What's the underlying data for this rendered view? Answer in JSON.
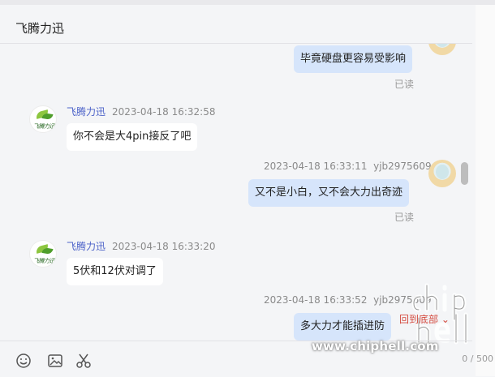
{
  "header": {
    "title": "飞腾力迅"
  },
  "messages": [
    {
      "side": "self",
      "text": "毕竟硬盘更容易受影响",
      "status": "已读"
    },
    {
      "side": "peer",
      "sender": "飞腾力迅",
      "time": "2023-04-18 16:32:58",
      "text": "你不会是大4pin接反了吧"
    },
    {
      "side": "self",
      "sender": "yjb2975609",
      "time": "2023-04-18 16:33:11",
      "text": "又不是小白，又不会大力出奇迹",
      "status": "已读"
    },
    {
      "side": "peer",
      "sender": "飞腾力迅",
      "time": "2023-04-18 16:33:20",
      "text": "5伏和12伏对调了"
    },
    {
      "side": "self",
      "sender": "yjb2975609",
      "time": "2023-04-18 16:33:52",
      "text": "多大力才能插进防"
    }
  ],
  "peer_avatar_text": "飞腾力迅",
  "goto_bottom": "回到底部",
  "input": {
    "counter": "0 / 500"
  },
  "toolbar": {
    "icons": [
      "emoji-icon",
      "image-icon",
      "scissors-icon"
    ]
  },
  "watermark": {
    "site": "www.chiphell.com",
    "logo": "chip hell"
  }
}
